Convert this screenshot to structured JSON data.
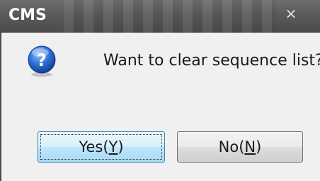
{
  "window": {
    "title": "CMS",
    "close_icon": "close-icon",
    "close_glyph": "×"
  },
  "message": {
    "icon": "question-icon",
    "text": "Want to clear sequence list?"
  },
  "buttons": {
    "yes": {
      "label": "Yes(",
      "mnemonic": "Y",
      "suffix": ")"
    },
    "no": {
      "label": "No(",
      "mnemonic": "N",
      "suffix": ")"
    }
  },
  "colors": {
    "titlebar": "#5a5a5a",
    "dialog_bg": "#f0f0f0",
    "icon_blue": "#2a63c0",
    "default_button_border": "#3c7fb1"
  }
}
